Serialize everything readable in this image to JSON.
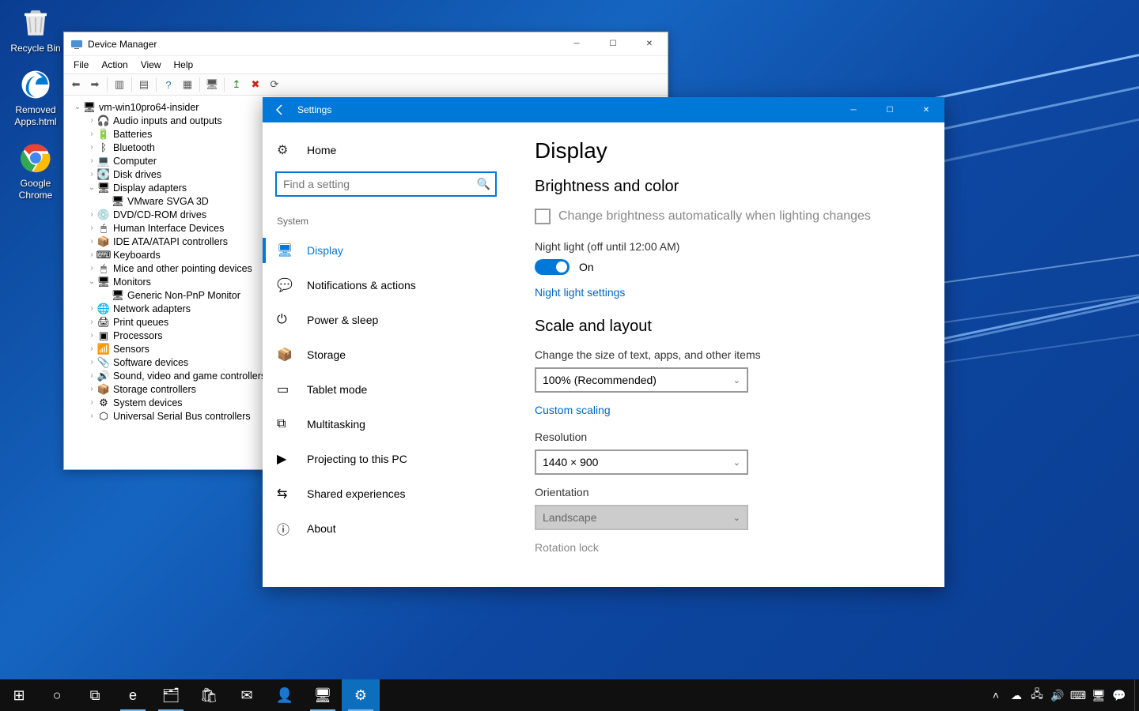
{
  "desktop": {
    "icons": [
      {
        "name": "recycle-bin",
        "label": "Recycle Bin"
      },
      {
        "name": "removed-apps",
        "label": "Removed Apps.html"
      },
      {
        "name": "google-chrome",
        "label": "Google Chrome"
      }
    ]
  },
  "deviceManager": {
    "title": "Device Manager",
    "menu": [
      "File",
      "Action",
      "View",
      "Help"
    ],
    "root": "vm-win10pro64-insider",
    "nodes": [
      {
        "label": "Audio inputs and outputs",
        "expanded": false,
        "icon": "audio"
      },
      {
        "label": "Batteries",
        "expanded": false,
        "icon": "battery"
      },
      {
        "label": "Bluetooth",
        "expanded": false,
        "icon": "bluetooth"
      },
      {
        "label": "Computer",
        "expanded": false,
        "icon": "computer"
      },
      {
        "label": "Disk drives",
        "expanded": false,
        "icon": "disk"
      },
      {
        "label": "Display adapters",
        "expanded": true,
        "icon": "display",
        "children": [
          {
            "label": "VMware SVGA 3D",
            "icon": "display"
          }
        ]
      },
      {
        "label": "DVD/CD-ROM drives",
        "expanded": false,
        "icon": "dvd"
      },
      {
        "label": "Human Interface Devices",
        "expanded": false,
        "icon": "hid"
      },
      {
        "label": "IDE ATA/ATAPI controllers",
        "expanded": false,
        "icon": "ide"
      },
      {
        "label": "Keyboards",
        "expanded": false,
        "icon": "keyboard"
      },
      {
        "label": "Mice and other pointing devices",
        "expanded": false,
        "icon": "mouse"
      },
      {
        "label": "Monitors",
        "expanded": true,
        "icon": "monitor",
        "children": [
          {
            "label": "Generic Non-PnP Monitor",
            "icon": "monitor"
          }
        ]
      },
      {
        "label": "Network adapters",
        "expanded": false,
        "icon": "network"
      },
      {
        "label": "Print queues",
        "expanded": false,
        "icon": "printer"
      },
      {
        "label": "Processors",
        "expanded": false,
        "icon": "cpu"
      },
      {
        "label": "Sensors",
        "expanded": false,
        "icon": "sensor"
      },
      {
        "label": "Software devices",
        "expanded": false,
        "icon": "software"
      },
      {
        "label": "Sound, video and game controllers",
        "expanded": false,
        "icon": "sound"
      },
      {
        "label": "Storage controllers",
        "expanded": false,
        "icon": "storage"
      },
      {
        "label": "System devices",
        "expanded": false,
        "icon": "system"
      },
      {
        "label": "Universal Serial Bus controllers",
        "expanded": false,
        "icon": "usb"
      }
    ]
  },
  "settings": {
    "windowTitle": "Settings",
    "homeLabel": "Home",
    "searchPlaceholder": "Find a setting",
    "categoryHeader": "System",
    "navItems": [
      {
        "key": "display",
        "label": "Display",
        "selected": true
      },
      {
        "key": "notifications",
        "label": "Notifications & actions"
      },
      {
        "key": "power",
        "label": "Power & sleep"
      },
      {
        "key": "storage",
        "label": "Storage"
      },
      {
        "key": "tablet",
        "label": "Tablet mode"
      },
      {
        "key": "multitasking",
        "label": "Multitasking"
      },
      {
        "key": "projecting",
        "label": "Projecting to this PC"
      },
      {
        "key": "shared",
        "label": "Shared experiences"
      },
      {
        "key": "about",
        "label": "About"
      }
    ],
    "page": {
      "title": "Display",
      "sectionBrightness": "Brightness and color",
      "autoBrightnessLabel": "Change brightness automatically when lighting changes",
      "nightLightLabel": "Night light (off until 12:00 AM)",
      "nightLightState": "On",
      "nightLightLink": "Night light settings",
      "sectionScale": "Scale and layout",
      "scaleLabel": "Change the size of text, apps, and other items",
      "scaleValue": "100% (Recommended)",
      "customScalingLink": "Custom scaling",
      "resolutionLabel": "Resolution",
      "resolutionValue": "1440 × 900",
      "orientationLabel": "Orientation",
      "orientationValue": "Landscape",
      "rotationLockLabel": "Rotation lock"
    }
  },
  "taskbar": {
    "buttons": [
      {
        "name": "start",
        "glyph": "⊞"
      },
      {
        "name": "cortana",
        "glyph": "○"
      },
      {
        "name": "task-view",
        "glyph": "⧉"
      },
      {
        "name": "edge",
        "glyph": "e",
        "running": true
      },
      {
        "name": "file-explorer",
        "glyph": "🗂",
        "running": true
      },
      {
        "name": "store",
        "glyph": "🛍"
      },
      {
        "name": "mail",
        "glyph": "✉"
      },
      {
        "name": "people",
        "glyph": "👤"
      },
      {
        "name": "device-manager-task",
        "glyph": "🖥",
        "running": true
      },
      {
        "name": "settings-task",
        "glyph": "⚙",
        "running": true,
        "active": true
      }
    ],
    "tray": [
      {
        "name": "tray-overflow",
        "glyph": "˄"
      },
      {
        "name": "onedrive",
        "glyph": "☁"
      },
      {
        "name": "network",
        "glyph": "🖧"
      },
      {
        "name": "volume",
        "glyph": "🔊"
      },
      {
        "name": "ime",
        "glyph": "⌨"
      },
      {
        "name": "ease-access",
        "glyph": "🖥"
      },
      {
        "name": "action-center",
        "glyph": "💬"
      }
    ]
  }
}
